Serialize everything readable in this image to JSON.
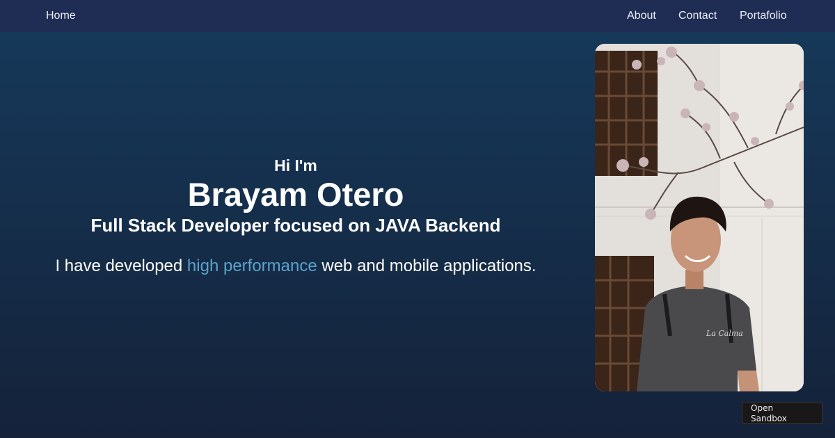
{
  "nav": {
    "home": "Home",
    "about": "About",
    "contact": "Contact",
    "portfolio": "Portafolio"
  },
  "hero": {
    "greeting": "Hi I'm",
    "name": "Brayam Otero",
    "role": "Full Stack Developer focused on JAVA Backend",
    "description_before": "I have developed ",
    "description_highlight": "high performance",
    "description_after": " web and mobile applications."
  },
  "sandbox": {
    "line1": "Open",
    "line2": "Sandbox"
  },
  "colors": {
    "navbar": "#1f2d55",
    "background_top": "#163a5c",
    "background_bottom": "#15223a",
    "highlight": "#5aa3cc",
    "text": "#ffffff"
  },
  "photo": {
    "alt": "portrait-photo"
  }
}
